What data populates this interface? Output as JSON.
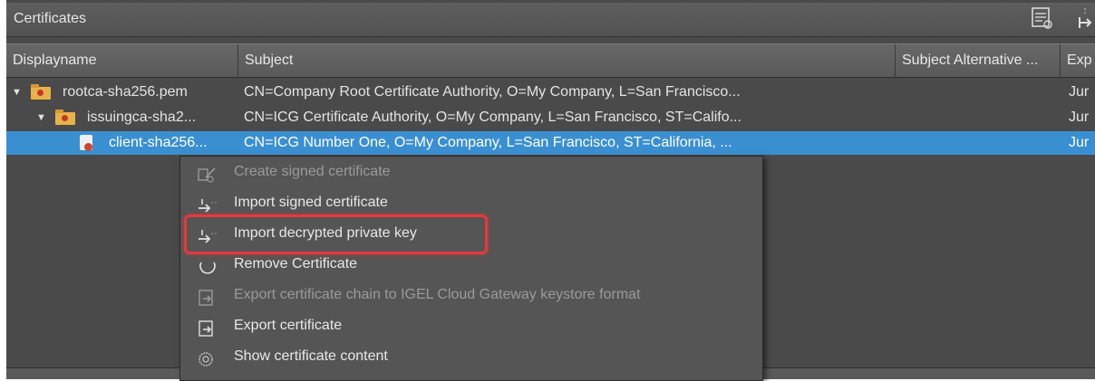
{
  "panel": {
    "title": "Certificates",
    "toolbar_icons": [
      "certificate-list-icon",
      "import-icon"
    ]
  },
  "table": {
    "columns": [
      "Displayname",
      "Subject",
      "Subject Alternative ...",
      "Exp"
    ],
    "rows": [
      {
        "name": "rootca-sha256.pem",
        "subject": "CN=Company Root Certificate Authority, O=My Company, L=San Francisco...",
        "expires": "Jur"
      },
      {
        "name": "issuingca-sha2...",
        "subject": "CN=ICG Certificate Authority, O=My Company, L=San Francisco, ST=Califo...",
        "expires": "Jur"
      },
      {
        "name": "client-sha256...",
        "subject": "CN=ICG Number One, O=My Company, L=San Francisco, ST=California, ...",
        "expires": "Jur",
        "selected": true
      }
    ]
  },
  "context_menu": {
    "items": [
      {
        "label": "Create signed certificate",
        "icon": "create-certificate-icon",
        "enabled": false
      },
      {
        "label": "Import signed certificate",
        "icon": "import-icon",
        "enabled": true
      },
      {
        "label": "Import decrypted private key",
        "icon": "import-icon",
        "enabled": true,
        "highlighted": true
      },
      {
        "label": "Remove Certificate",
        "icon": "remove-icon",
        "enabled": true
      },
      {
        "label": "Export certificate chain to IGEL Cloud Gateway keystore format",
        "icon": "export-icon",
        "enabled": false
      },
      {
        "label": "Export certificate",
        "icon": "export-icon",
        "enabled": true
      },
      {
        "label": "Show certificate content",
        "icon": "certificate-content-icon",
        "enabled": true
      }
    ]
  },
  "colors": {
    "panel_bg": "#4a4a4a",
    "selection": "#3a8fd1",
    "highlight_box": "#e8383d"
  }
}
